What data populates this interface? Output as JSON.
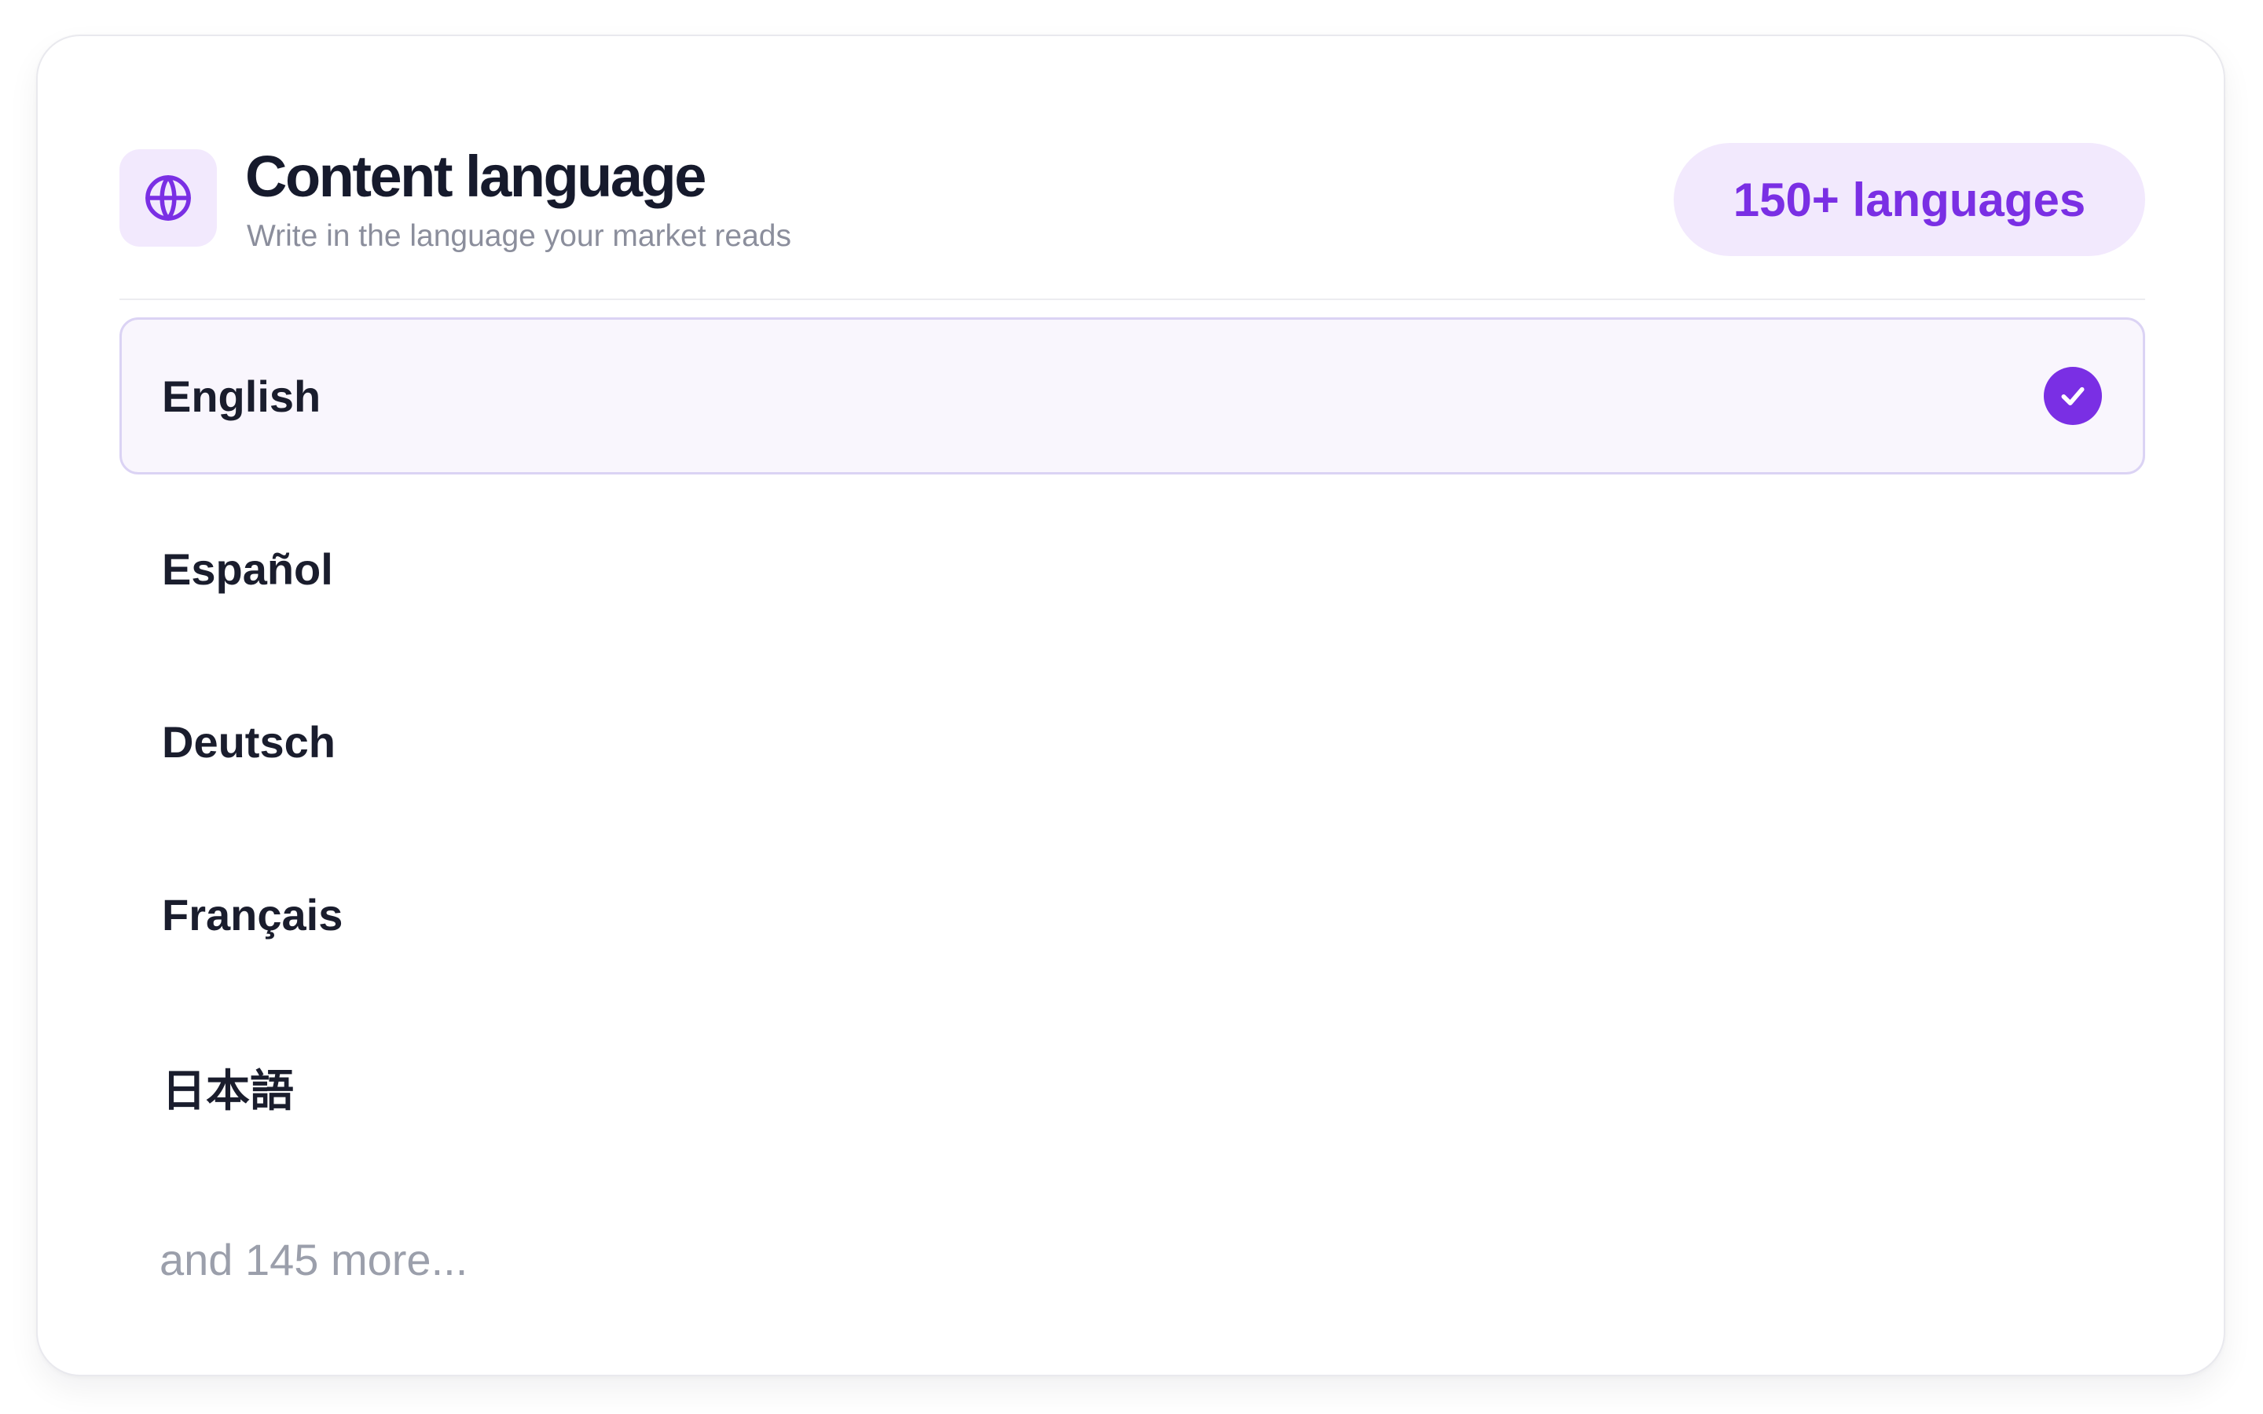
{
  "card": {
    "title": "Content language",
    "subtitle": "Write in the language your market reads",
    "badge": "150+ languages",
    "icon": "globe-icon"
  },
  "languages": [
    {
      "label": "English",
      "selected": true
    },
    {
      "label": "Español",
      "selected": false
    },
    {
      "label": "Deutsch",
      "selected": false
    },
    {
      "label": "Français",
      "selected": false
    },
    {
      "label": "日本語",
      "selected": false
    }
  ],
  "more_text": "and 145 more...",
  "colors": {
    "accent": "#7a2fe4",
    "accent_soft": "#f2e9fd",
    "selected_bg": "#f9f6fd",
    "selected_border": "#dbd3f4",
    "text_primary": "#1a1d2d",
    "text_muted": "#8b8e9c"
  }
}
